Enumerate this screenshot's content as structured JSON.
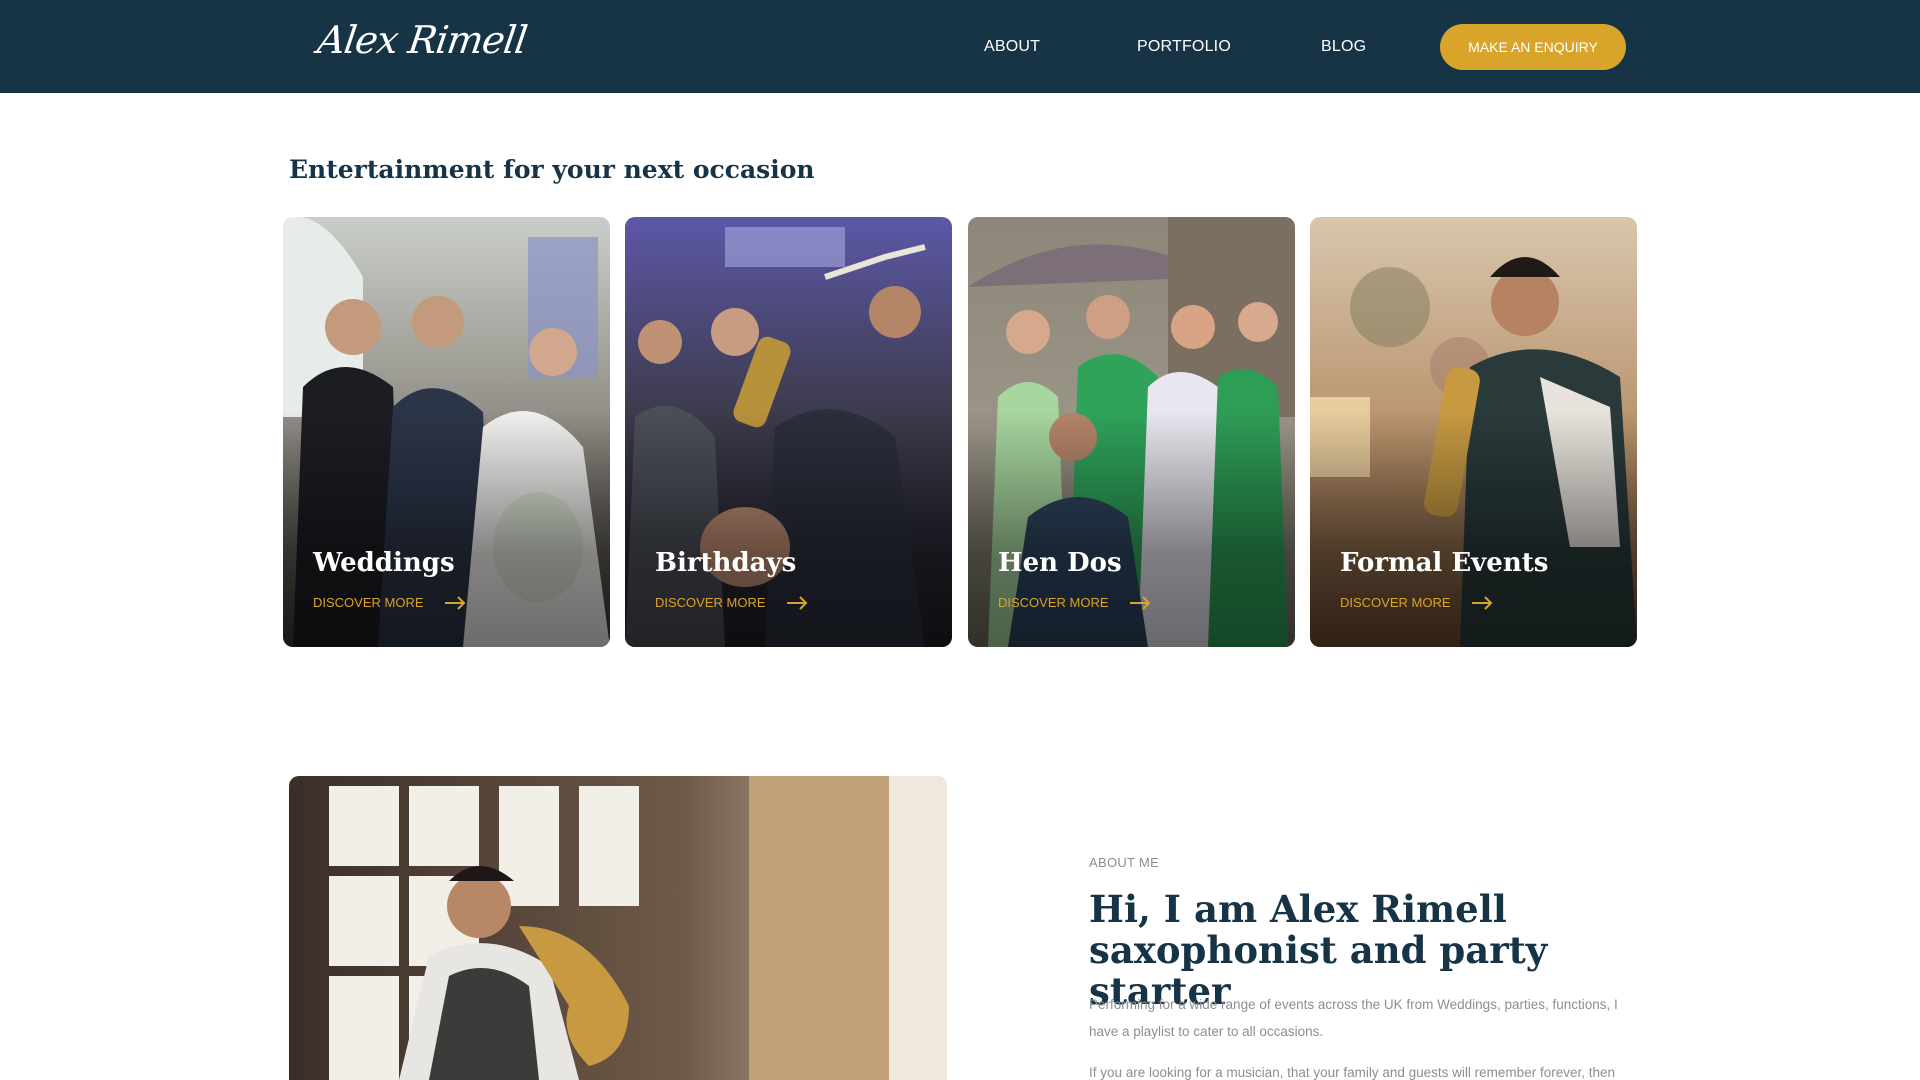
{
  "header": {
    "logo_text": "Alex Rimell",
    "nav": [
      "ABOUT",
      "PORTFOLIO",
      "BLOG"
    ],
    "cta_label": "MAKE AN ENQUIRY"
  },
  "occasions": {
    "title": "Entertainment for your next occasion",
    "cards": [
      {
        "title": "Weddings",
        "link": "DISCOVER MORE"
      },
      {
        "title": "Birthdays",
        "link": "DISCOVER MORE"
      },
      {
        "title": "Hen Dos",
        "link": "DISCOVER MORE"
      },
      {
        "title": "Formal Events",
        "link": "DISCOVER MORE"
      }
    ]
  },
  "about": {
    "label": "ABOUT ME",
    "heading_line1": "Hi, I am Alex Rimell",
    "heading_line2": "saxophonist and party starter",
    "paragraph1": "Performing for a wide range of events across the UK from Weddings, parties, functions, I have a playlist to cater to all occasions.",
    "paragraph2": "If you are looking for a musician, that your family and guests will remember forever, then"
  },
  "colors": {
    "navy": "#173447",
    "gold": "#d9a42a",
    "muted": "#8a8f95"
  }
}
